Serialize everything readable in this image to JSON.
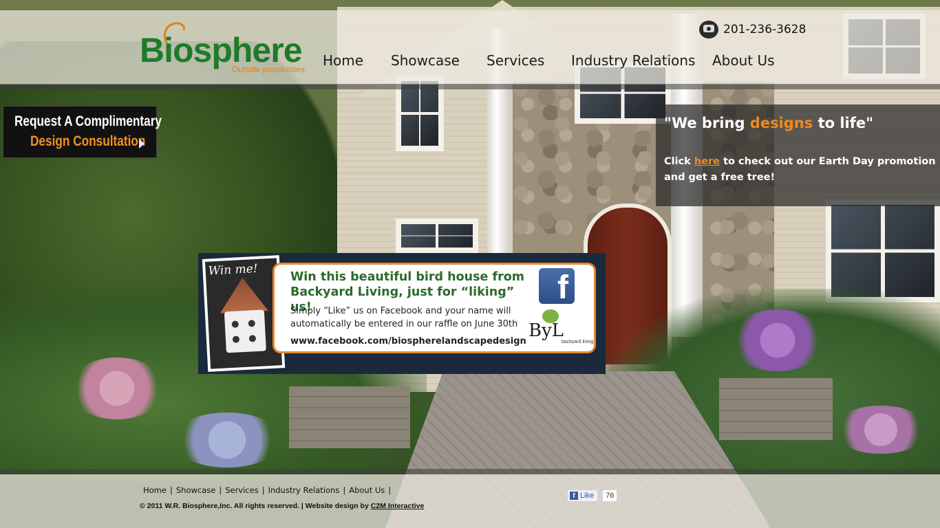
{
  "header": {
    "logo_word": "Biosphere",
    "logo_tagline": "Outside possibilities",
    "phone": "201-236-3628",
    "nav": [
      {
        "label": "Home"
      },
      {
        "label": "Showcase"
      },
      {
        "label": "Services"
      },
      {
        "label": "Industry Relations"
      },
      {
        "label": "About Us"
      }
    ]
  },
  "consultation": {
    "line1": "Request A Complimentary",
    "line2": "Design Consultation"
  },
  "tagline": {
    "quote_open": "\"We bring ",
    "quote_accent": "designs",
    "quote_close": " to life\"",
    "body_prefix": "Click ",
    "body_link": "here",
    "body_suffix": " to check out our Earth Day promotion and get a free tree!"
  },
  "promo": {
    "photo_caption": "Win me!",
    "headline": "Win this beautiful bird house from Backyard Living, just for “liking” us!",
    "body": "Simply  “Like” us on Facebook and your name will automatically be entered in our raffle on June 30th",
    "url": "www.facebook.com/biospherelandscapedesign",
    "byl_mark": "ByL",
    "byl_name": "backyard living"
  },
  "footer": {
    "links": [
      {
        "label": "Home"
      },
      {
        "label": "Showcase"
      },
      {
        "label": "Services"
      },
      {
        "label": "Industry Relations"
      },
      {
        "label": "About Us"
      }
    ],
    "copyright_prefix": "© 2011 W.R. Biosphere,Inc. All rights reserved. | Website design by ",
    "credit": "C2M Interactive",
    "like_label": "Like",
    "like_count": "76"
  },
  "colors": {
    "brand_green": "#1f7a2a",
    "accent_orange": "#f08a1c",
    "facebook_blue": "#3b5998"
  }
}
